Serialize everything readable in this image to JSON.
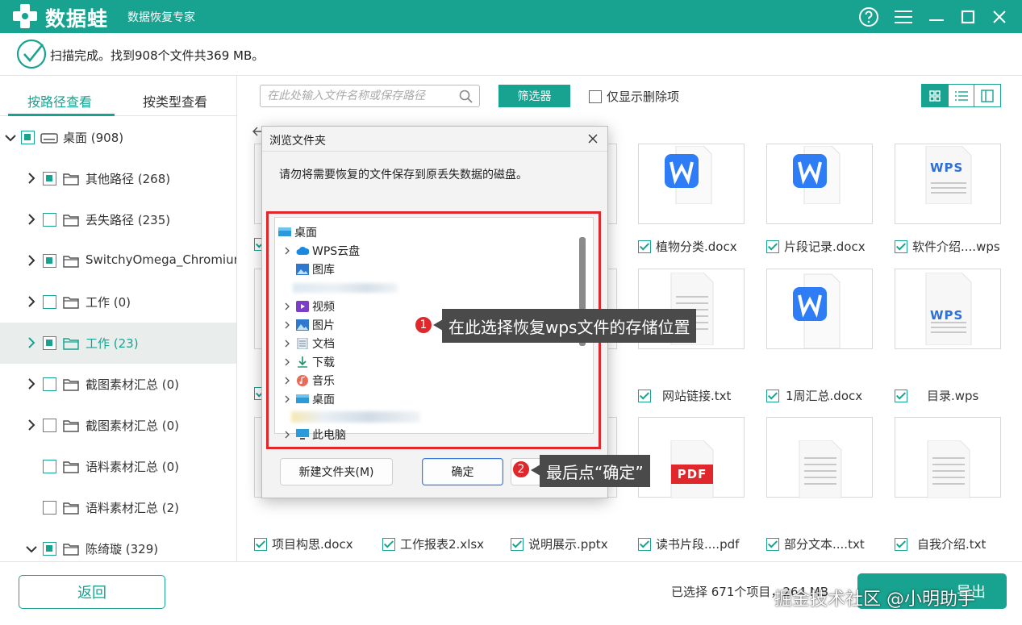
{
  "app": {
    "brand": "数据蛙",
    "subtitle": "数据恢复专家"
  },
  "status": {
    "text": "扫描完成。找到908个文件共369 MB。"
  },
  "tabs": {
    "by_path": "按路径查看",
    "by_type": "按类型查看"
  },
  "tree": [
    {
      "label": "桌面 (908)",
      "checked": true,
      "expanded": true
    },
    {
      "label": "其他路径 (268)",
      "checked": true
    },
    {
      "label": "丢失路径 (235)",
      "checked": false
    },
    {
      "label": "SwitchyOmega_Chromium",
      "checked": true
    },
    {
      "label": "工作 (0)",
      "checked": false
    },
    {
      "label": "工作 (23)",
      "checked": true,
      "selected": true
    },
    {
      "label": "截图素材汇总 (0)",
      "checked": false
    },
    {
      "label": "截图素材汇总 (0)",
      "checked": false
    },
    {
      "label": "语料素材汇总 (0)",
      "checked": false
    },
    {
      "label": "语料素材汇总 (2)",
      "checked": false
    },
    {
      "label": "陈绮璇 (329)",
      "checked": true,
      "expanded": true
    }
  ],
  "toolbar": {
    "search_placeholder": "在此处输入文件名称或保存路径",
    "filter_label": "筛选器",
    "deleted_only_label": "仅显示删除项"
  },
  "files": {
    "row1": [
      "植物分类.docx",
      "片段记录.docx",
      "软件介绍....wps"
    ],
    "row2": [
      "网站链接.txt",
      "1周汇总.docx",
      "目录.wps"
    ],
    "row3": [
      "项目构思.docx",
      "工作报表2.xlsx",
      "说明展示.pptx",
      "读书片段....pdf",
      "部分文本....txt",
      "自我介绍.txt"
    ]
  },
  "pdf_badge": "PDF",
  "wps_badge": "WPS",
  "dialog": {
    "title": "浏览文件夹",
    "message": "请勿将需要恢复的文件保存到原丢失数据的磁盘。",
    "tree": [
      {
        "label": "桌面"
      },
      {
        "label": "WPS云盘"
      },
      {
        "label": "图库"
      },
      {
        "label": "视频"
      },
      {
        "label": "图片"
      },
      {
        "label": "文档"
      },
      {
        "label": "下载"
      },
      {
        "label": "音乐"
      },
      {
        "label": "桌面"
      },
      {
        "label": "此电脑"
      }
    ],
    "new_folder": "新建文件夹(M)",
    "ok": "确定"
  },
  "callouts": {
    "step1_num": "1",
    "step1_text": "在此选择恢复wps文件的存储位置",
    "step2_num": "2",
    "step2_text": "最后点“确定”"
  },
  "bottom": {
    "back": "返回",
    "selected_info": "已选择 671个项目，264 MB",
    "export": "导出",
    "watermark": "掘金技术社区 @小明助手"
  },
  "colors": {
    "accent": "#17a390",
    "highlight_red": "#e0272b"
  }
}
